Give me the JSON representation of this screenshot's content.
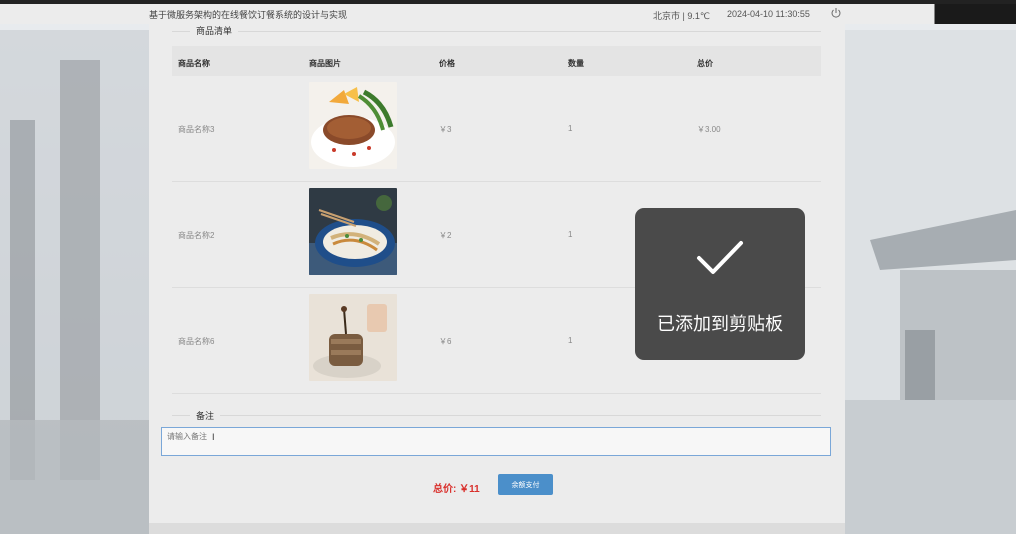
{
  "topbar": {
    "title": "基于微服务架构的在线餐饮订餐系统的设计与实现",
    "weather": "北京市 | 9.1℃",
    "datetime": "2024-04-10  11:30:55",
    "power_icon": "power-icon"
  },
  "product_section": {
    "title": "商品清单",
    "headers": [
      "商品名称",
      "商品图片",
      "价格",
      "数量",
      "总价"
    ],
    "rows": [
      {
        "name": "商品名称3",
        "image": "steak-dish",
        "price": "￥3",
        "qty": "1",
        "total": "￥3.00"
      },
      {
        "name": "商品名称2",
        "image": "noodle-dish",
        "price": "￥2",
        "qty": "1",
        "total": ""
      },
      {
        "name": "商品名称6",
        "image": "dessert-dish",
        "price": "￥6",
        "qty": "1",
        "total": ""
      }
    ]
  },
  "remark_section": {
    "title": "备注",
    "placeholder": "请输入备注"
  },
  "footer": {
    "total_label": "总价: ￥11",
    "pay_button": "余额支付"
  },
  "toast": {
    "icon": "checkmark-icon",
    "message": "已添加到剪贴板"
  },
  "colors": {
    "accent": "#4b8fca",
    "total_red": "#d9302c",
    "toast_bg": "#4a4a4a"
  }
}
